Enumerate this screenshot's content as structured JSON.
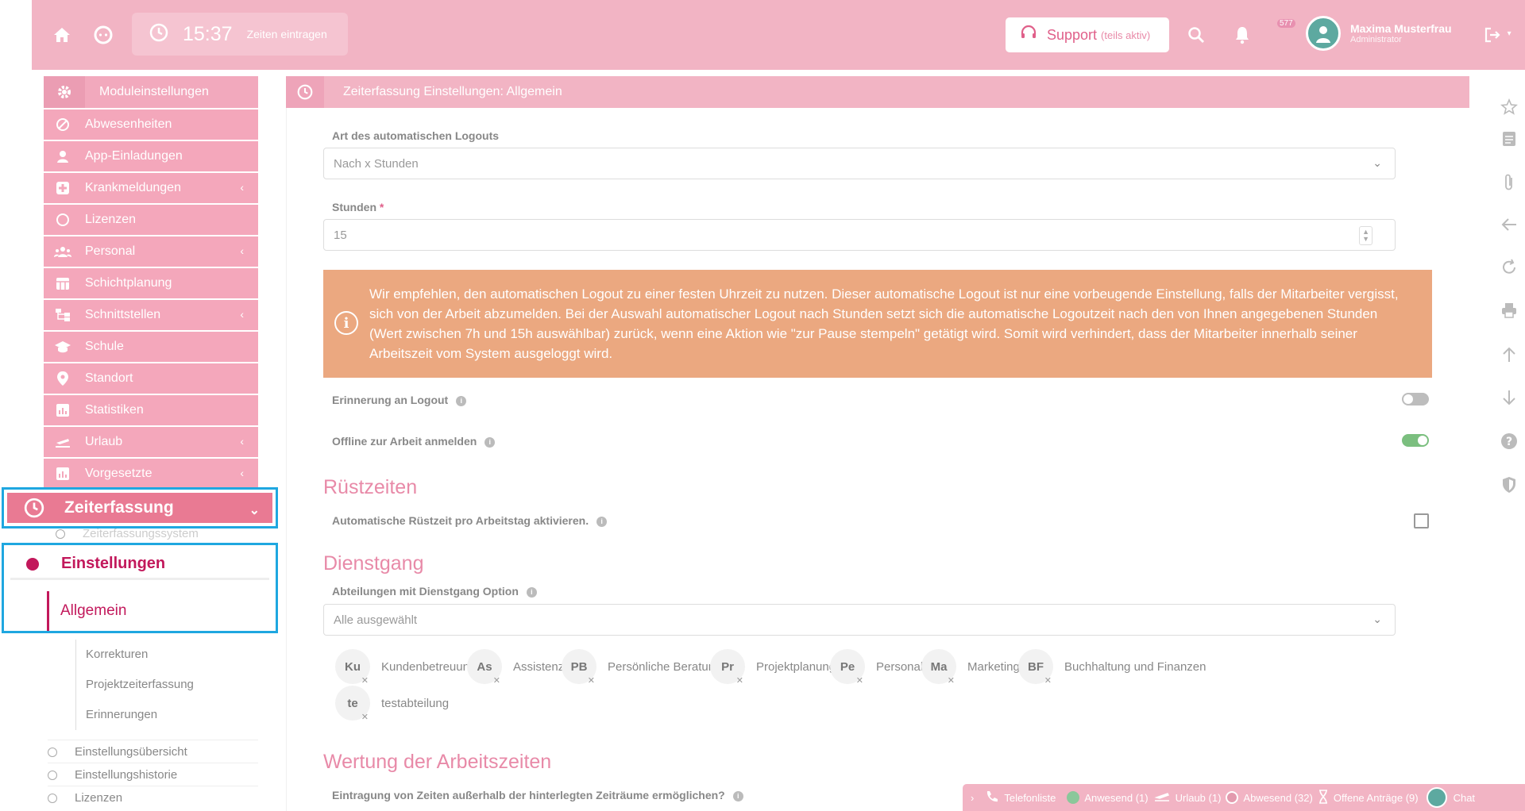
{
  "header": {
    "time": "15:37",
    "time_entry_label": "Zeiten eintragen",
    "support_label": "Support",
    "support_note": "(teils aktiv)",
    "notification_count": "577",
    "user_name": "Maxima Musterfrau",
    "user_role": "Administrator"
  },
  "sidebar": {
    "module_settings": "Moduleinstellungen",
    "items": [
      {
        "label": "Abwesenheiten",
        "icon": "ban-icon",
        "chevron": false
      },
      {
        "label": "App-Einladungen",
        "icon": "user-icon",
        "chevron": false
      },
      {
        "label": "Krankmeldungen",
        "icon": "medical-icon",
        "chevron": true
      },
      {
        "label": "Lizenzen",
        "icon": "circle-icon",
        "chevron": false
      },
      {
        "label": "Personal",
        "icon": "people-icon",
        "chevron": true
      },
      {
        "label": "Schichtplanung",
        "icon": "calendar-icon",
        "chevron": false
      },
      {
        "label": "Schnittstellen",
        "icon": "sitemap-icon",
        "chevron": true
      },
      {
        "label": "Schule",
        "icon": "graduation-icon",
        "chevron": false
      },
      {
        "label": "Standort",
        "icon": "pin-icon",
        "chevron": false
      },
      {
        "label": "Statistiken",
        "icon": "chart-icon",
        "chevron": false
      },
      {
        "label": "Urlaub",
        "icon": "plane-icon",
        "chevron": true
      },
      {
        "label": "Vorgesetzte",
        "icon": "chart-icon",
        "chevron": true
      }
    ],
    "active_module": "Zeiterfassung",
    "sub_system": "Zeiterfassungssystem",
    "einstellungen": "Einstellungen",
    "allgemein": "Allgemein",
    "subitems": [
      "Korrekturen",
      "Projektzeiterfassung",
      "Erinnerungen"
    ],
    "lower_items": [
      "Einstellungsübersicht",
      "Einstellungshistorie",
      "Lizenzen"
    ]
  },
  "main": {
    "title": "Zeiterfassung Einstellungen: Allgemein",
    "logout_type_label": "Art des automatischen Logouts",
    "logout_type_value": "Nach x Stunden",
    "hours_label": "Stunden",
    "hours_required": "*",
    "hours_value": "15",
    "alert_text": "Wir empfehlen, den automatischen Logout zu einer festen Uhrzeit zu nutzen. Dieser automatische Logout ist nur eine vorbeugende Einstellung, falls der Mitarbeiter vergisst, sich von der Arbeit abzumelden. Bei der Auswahl automatischer Logout nach Stunden setzt sich die automatische Logoutzeit nach den von Ihnen angegebenen Stunden (Wert zwischen 7h und 15h auswählbar) zurück, wenn eine Aktion wie \"zur Pause stempeln\" getätigt wird. Somit wird verhindert, dass der Mitarbeiter innerhalb seiner Arbeitszeit vom System ausgeloggt wird.",
    "reminder_label": "Erinnerung an Logout",
    "offline_label": "Offline zur Arbeit anmelden",
    "ruest_title": "Rüstzeiten",
    "ruest_label": "Automatische Rüstzeit pro Arbeitstag aktivieren.",
    "dienst_title": "Dienstgang",
    "dienst_label": "Abteilungen mit Dienstgang Option",
    "dienst_value": "Alle ausgewählt",
    "departments": [
      {
        "abbr": "Ku",
        "name": "Kundenbetreuung"
      },
      {
        "abbr": "As",
        "name": "Assistenz"
      },
      {
        "abbr": "PB",
        "name": "Persönliche Beratung"
      },
      {
        "abbr": "Pr",
        "name": "Projektplanung"
      },
      {
        "abbr": "Pe",
        "name": "Personal"
      },
      {
        "abbr": "Ma",
        "name": "Marketing"
      },
      {
        "abbr": "BF",
        "name": "Buchhaltung und Finanzen"
      },
      {
        "abbr": "te",
        "name": "testabteilung"
      }
    ],
    "wertung_title": "Wertung der Arbeitszeiten",
    "wertung_label": "Eintragung von Zeiten außerhalb der hinterlegten Zeiträume ermöglichen?"
  },
  "toggles": {
    "reminder_on": false,
    "offline_on": true
  },
  "footer": {
    "phone": "Telefonliste",
    "present": "Anwesend (1)",
    "vacation": "Urlaub (1)",
    "absent": "Abwesend (32)",
    "requests": "Offene Anträge (9)",
    "chat": "Chat"
  },
  "colors": {
    "accent": "#f2b4c4",
    "active": "#e97a93",
    "highlight": "#1fa7e0",
    "alert": "#eba880"
  }
}
